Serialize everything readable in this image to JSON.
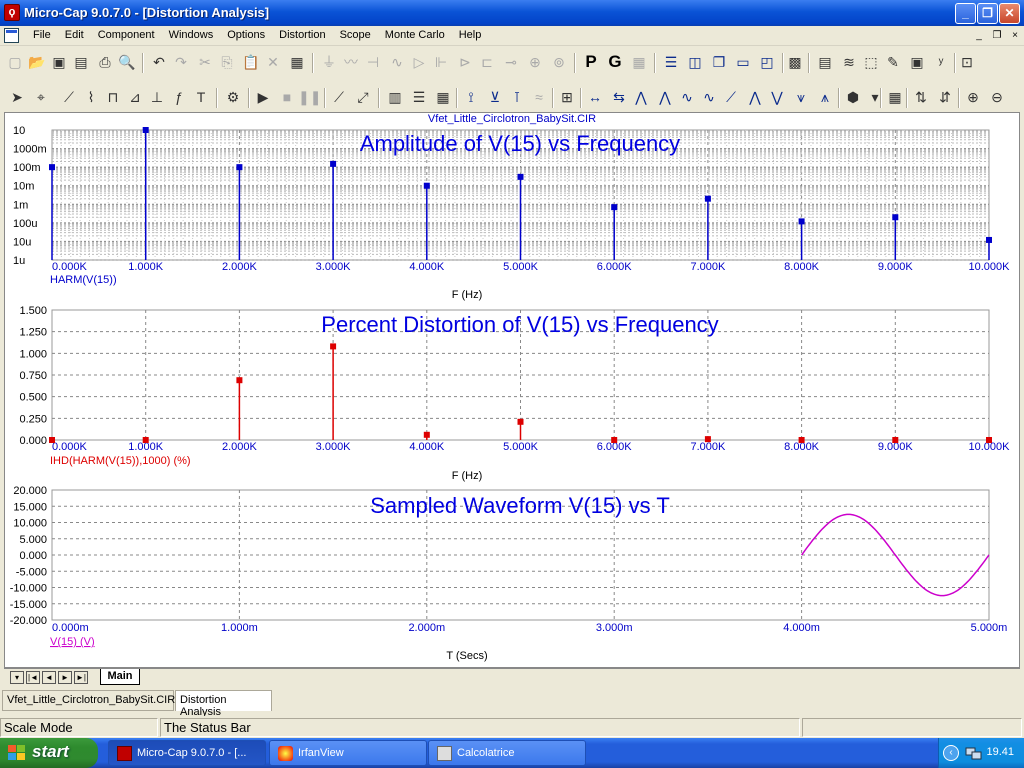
{
  "window": {
    "title": "Micro-Cap 9.0.7.0 - [Distortion Analysis]",
    "app_icon": "microcap-icon",
    "min_label": "_",
    "max_label": "❐",
    "close_label": "✕"
  },
  "menu": {
    "items": [
      "File",
      "Edit",
      "Component",
      "Windows",
      "Options",
      "Distortion",
      "Scope",
      "Monte Carlo",
      "Help"
    ],
    "mdi_min": "_",
    "mdi_restore": "❐",
    "mdi_close": "×"
  },
  "toolbar1": {
    "big_p": "P",
    "big_g": "G"
  },
  "toolbar2": {
    "text_tool": "T"
  },
  "circuit_file": "Vfet_Little_Circlotron_BabySit.CIR",
  "chart_data": [
    {
      "type": "bar",
      "title": "Amplitude of V(15) vs Frequency",
      "xlabel": "F (Hz)",
      "ylabel": "HARM(V(15))",
      "yscale": "log",
      "ytick_labels": [
        "10",
        "1000m",
        "100m",
        "10m",
        "1m",
        "100u",
        "10u",
        "1u"
      ],
      "xtick_labels": [
        "0.000K",
        "1.000K",
        "2.000K",
        "3.000K",
        "4.000K",
        "5.000K",
        "6.000K",
        "7.000K",
        "8.000K",
        "9.000K",
        "10.000K"
      ],
      "x": [
        0,
        1000,
        2000,
        3000,
        4000,
        5000,
        6000,
        7000,
        8000,
        9000,
        10000
      ],
      "values": [
        0.1,
        10,
        0.1,
        0.15,
        0.01,
        0.03,
        0.0007,
        0.002,
        0.00012,
        0.0002,
        1.2e-05
      ],
      "ylim": [
        1e-06,
        10
      ],
      "xlim": [
        0,
        10000
      ],
      "color": "#0000cc",
      "grid": true
    },
    {
      "type": "bar",
      "title": "Percent Distortion of V(15) vs Frequency",
      "xlabel": "F (Hz)",
      "ylabel": "IHD(HARM(V(15)),1000) (%)",
      "ytick_labels": [
        "1.500",
        "1.250",
        "1.000",
        "0.750",
        "0.500",
        "0.250",
        "0.000"
      ],
      "xtick_labels": [
        "0.000K",
        "1.000K",
        "2.000K",
        "3.000K",
        "4.000K",
        "5.000K",
        "6.000K",
        "7.000K",
        "8.000K",
        "9.000K",
        "10.000K"
      ],
      "x": [
        0,
        1000,
        2000,
        3000,
        4000,
        5000,
        6000,
        7000,
        8000,
        9000,
        10000
      ],
      "values": [
        0.0,
        0.0,
        0.69,
        1.08,
        0.06,
        0.21,
        0.0,
        0.01,
        0.0,
        0.0,
        0.0
      ],
      "ylim": [
        0,
        1.5
      ],
      "xlim": [
        0,
        10000
      ],
      "color": "#dd0000",
      "grid": true
    },
    {
      "type": "line",
      "title": "Sampled Waveform  V(15) vs T",
      "xlabel": "T (Secs)",
      "ylabel": "V(15) (V)",
      "ytick_labels": [
        "20.000",
        "15.000",
        "10.000",
        "5.000",
        "0.000",
        "-5.000",
        "-10.000",
        "-15.000",
        "-20.000"
      ],
      "xtick_labels": [
        "0.000m",
        "1.000m",
        "2.000m",
        "3.000m",
        "4.000m",
        "5.000m"
      ],
      "ylim": [
        -20,
        20
      ],
      "xlim": [
        0,
        0.005
      ],
      "series": [
        {
          "amplitude": 12.5,
          "frequency": 1000,
          "t_start": 0.004,
          "t_end": 0.005,
          "color": "#cc00cc"
        }
      ],
      "grid": true
    }
  ],
  "sheet": {
    "tab": "Main",
    "nav": [
      "◄",
      "|◄",
      "◄",
      "►",
      "►|"
    ]
  },
  "doc_tabs": [
    "Vfet_Little_Circlotron_BabySit.CIR",
    "Distortion Analysis"
  ],
  "status": {
    "mode": "Scale Mode",
    "message": "The Status Bar"
  },
  "taskbar": {
    "start": "start",
    "items": [
      "Micro-Cap 9.0.7.0 - [...",
      "IrfanView",
      "Calcolatrice"
    ],
    "clock": "19.41"
  }
}
